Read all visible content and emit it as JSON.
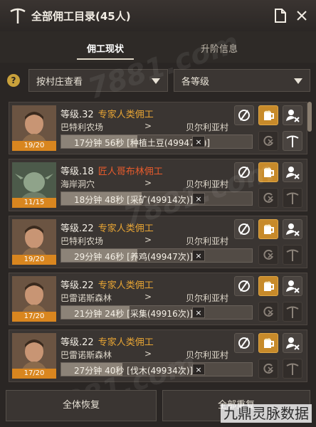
{
  "title": "全部佣工目录(45人)",
  "tabs": [
    {
      "label": "佣工现状",
      "active": true
    },
    {
      "label": "升阶信息",
      "active": false
    }
  ],
  "filters": {
    "help": "?",
    "village": "按村庄查看",
    "level": "各等级"
  },
  "workers": [
    {
      "level": "等级.32",
      "role": "专家人类佣工",
      "role_color": "orange",
      "from": "巴特利农场",
      "arrow": ">",
      "to": "贝尔利亚村",
      "count": "19/20",
      "task": "17分钟 56秒 [种植土豆(49947次)]",
      "progress": 0.4,
      "portrait": "human"
    },
    {
      "level": "等级.18",
      "role": "匠人哥布林佣工",
      "role_color": "red",
      "from": "海岸洞穴",
      "arrow": ">",
      "to": "贝尔利亚村",
      "count": "11/15",
      "task": "18分钟 48秒 [采矿(49914次)]",
      "progress": 0.42,
      "portrait": "goblin"
    },
    {
      "level": "等级.22",
      "role": "专家人类佣工",
      "role_color": "orange",
      "from": "巴特利农场",
      "arrow": ">",
      "to": "贝尔利亚村",
      "count": "19/20",
      "task": "29分钟 46秒 [养鸡(49947次)]",
      "progress": 0.4,
      "portrait": "human"
    },
    {
      "level": "等级.22",
      "role": "专家人类佣工",
      "role_color": "orange",
      "from": "巴雷诺斯森林",
      "arrow": ">",
      "to": "贝尔利亚村",
      "count": "17/20",
      "task": "21分钟 24秒 [采集(49916次)]",
      "progress": 0.36,
      "portrait": "human"
    },
    {
      "level": "等级.22",
      "role": "专家人类佣工",
      "role_color": "orange",
      "from": "巴雷诺斯森林",
      "arrow": ">",
      "to": "贝尔利亚村",
      "count": "17/20",
      "task": "27分钟 40秒 [伐木(49934次)]",
      "progress": 0.32,
      "portrait": "human"
    }
  ],
  "bottom_buttons": [
    {
      "label": "全体恢复"
    },
    {
      "label": "全部重复"
    }
  ],
  "watermark": "九鼎灵脉数据",
  "faint_watermark": "7881.com",
  "colors": {
    "accent": "#c78a2a",
    "orange": "#e8a534",
    "red": "#e85b2c",
    "count_bar": "#d9861f"
  }
}
